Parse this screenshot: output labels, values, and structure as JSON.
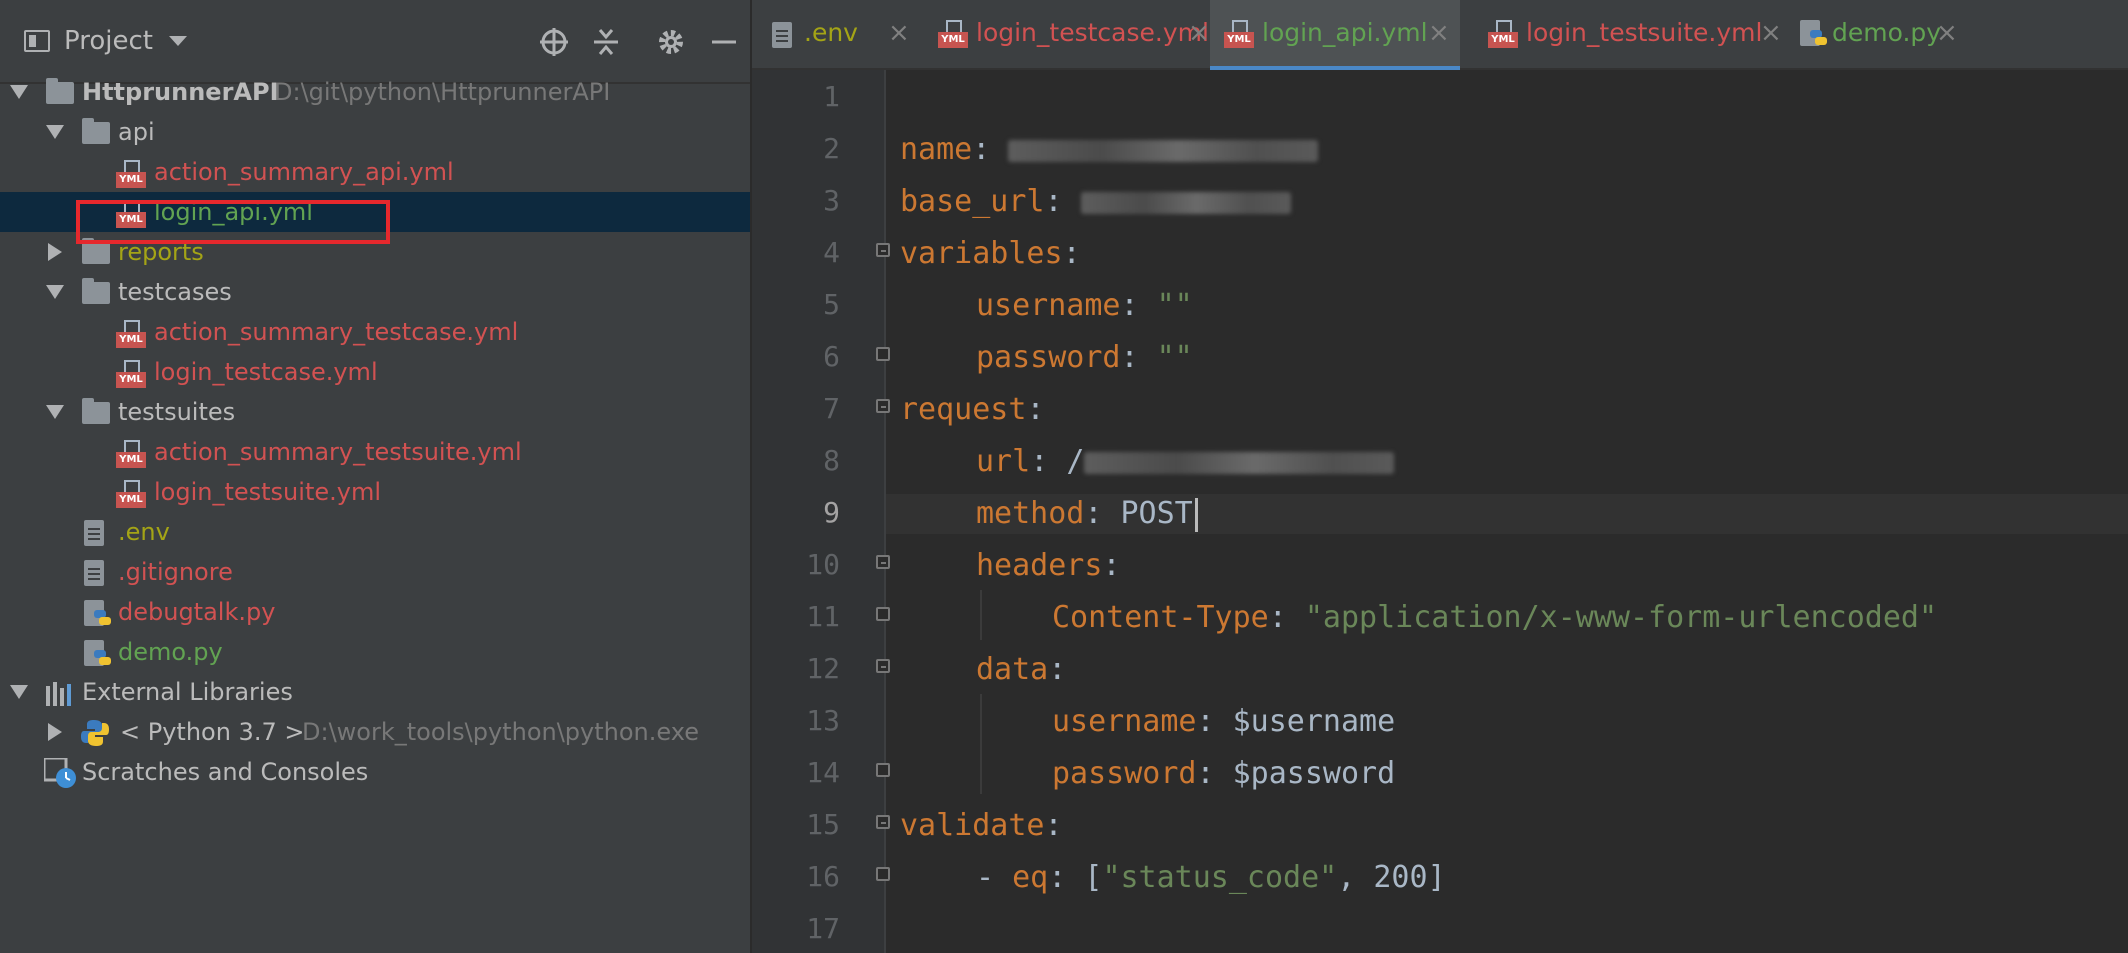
{
  "project_panel": {
    "title": "Project",
    "icons": [
      "target-icon",
      "collapse-all-icon",
      "gear-icon",
      "minimize-icon"
    ],
    "tree": [
      {
        "label": "HttprunnerAPI",
        "path": "D:\\git\\python\\HttprunnerAPI",
        "type": "root"
      },
      {
        "label": "api",
        "type": "folder"
      },
      {
        "label": "action_summary_api.yml",
        "type": "yml"
      },
      {
        "label": "login_api.yml",
        "type": "yml"
      },
      {
        "label": "reports",
        "type": "folder"
      },
      {
        "label": "testcases",
        "type": "folder"
      },
      {
        "label": "action_summary_testcase.yml",
        "type": "yml"
      },
      {
        "label": "login_testcase.yml",
        "type": "yml"
      },
      {
        "label": "testsuites",
        "type": "folder"
      },
      {
        "label": "action_summary_testsuite.yml",
        "type": "yml"
      },
      {
        "label": "login_testsuite.yml",
        "type": "yml"
      },
      {
        "label": ".env",
        "type": "file"
      },
      {
        "label": ".gitignore",
        "type": "file"
      },
      {
        "label": "debugtalk.py",
        "type": "py"
      },
      {
        "label": "demo.py",
        "type": "py"
      },
      {
        "label": "External Libraries",
        "type": "libraries"
      },
      {
        "label": "< Python 3.7 >",
        "path": "D:\\work_tools\\python\\python.exe",
        "type": "sdk"
      },
      {
        "label": "Scratches and Consoles",
        "type": "scratches"
      }
    ]
  },
  "tabs": [
    {
      "label": ".env",
      "close": "×"
    },
    {
      "label": "login_testcase.yml",
      "close": "×"
    },
    {
      "label": "login_api.yml",
      "close": "×"
    },
    {
      "label": "login_testsuite.yml",
      "close": "×"
    },
    {
      "label": "demo.py",
      "close": "×"
    }
  ],
  "editor": {
    "line_numbers": [
      "1",
      "2",
      "3",
      "4",
      "5",
      "6",
      "7",
      "8",
      "9",
      "10",
      "11",
      "12",
      "13",
      "14",
      "15",
      "16",
      "17"
    ],
    "current_line": "9",
    "code": {
      "l2_key": "name",
      "l2_colon": ": ",
      "l3_key": "base_url",
      "l3_colon": ": ",
      "l4_key": "variables",
      "l4_colon": ":",
      "l5_key": "username",
      "l5_colon": ": ",
      "l5_val": "\"\"",
      "l6_key": "password",
      "l6_colon": ": ",
      "l6_val": "\"\"",
      "l7_key": "request",
      "l7_colon": ":",
      "l8_key": "url",
      "l8_colon": ": ",
      "l8_val": "/",
      "l9_key": "method",
      "l9_colon": ": ",
      "l9_val": "POST",
      "l10_key": "headers",
      "l10_colon": ":",
      "l11_key": "Content-Type",
      "l11_colon": ": ",
      "l11_val": "\"application/x-www-form-urlencoded\"",
      "l12_key": "data",
      "l12_colon": ":",
      "l13_key": "username",
      "l13_colon": ": ",
      "l13_val": "$username",
      "l14_key": "password",
      "l14_colon": ": ",
      "l14_val": "$password",
      "l15_key": "validate",
      "l15_colon": ":",
      "l16_dash": "- ",
      "l16_key": "eq",
      "l16_colon": ": ",
      "l16_open": "[",
      "l16_s": "\"status_code\"",
      "l16_sep": ", ",
      "l16_num": "200",
      "l16_close": "]"
    }
  },
  "colors": {
    "panel_bg": "#3c3f41",
    "editor_bg": "#2b2b2b",
    "modified_red": "#d25252",
    "added_green": "#62a352",
    "ignored_olive": "#a4a416",
    "yaml_key": "#cc7832",
    "yaml_string": "#6a8759",
    "highlight_box": "#e6282d",
    "active_tab_underline": "#4a88c7"
  }
}
